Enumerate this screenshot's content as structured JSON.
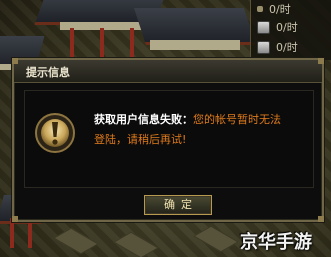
{
  "resources": [
    {
      "icon": "shield-icon",
      "value": "0/时"
    },
    {
      "icon": "horse-icon",
      "value": "0/时"
    },
    {
      "icon": "ore-icon",
      "value": "0/时"
    }
  ],
  "dialog": {
    "title": "提示信息",
    "message_title": "获取用户信息失败：",
    "message_body": "您的帐号暂时无法登陆，请稍后再试!",
    "confirm_label": "确定"
  },
  "watermark": "京华手游",
  "colors": {
    "dialog_border": "#6f6547",
    "message_title": "#ffffff",
    "message_body": "#e07a1c",
    "button_border": "#b59a4f"
  }
}
